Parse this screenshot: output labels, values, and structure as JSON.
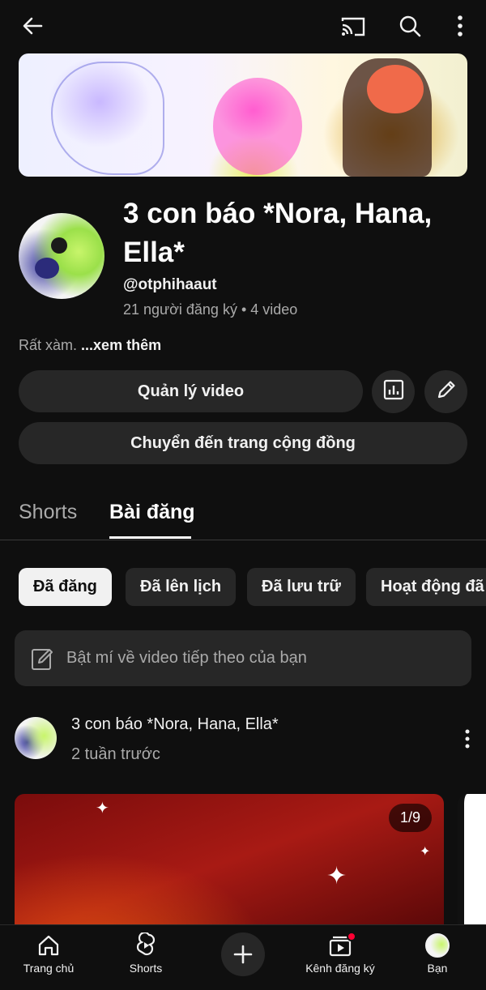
{
  "header": {
    "back_icon": "arrow-left-icon",
    "cast_icon": "cast-icon",
    "search_icon": "search-icon",
    "more_icon": "more-vert-icon"
  },
  "channel": {
    "name": "3 con báo *Nora, Hana, Ella*",
    "handle": "@otphihaaut",
    "stats": "21 người đăng ký • 4 video",
    "description": "Rất xàm.",
    "more_link": "...xem thêm"
  },
  "actions": {
    "manage_videos": "Quản lý video",
    "analytics_icon": "analytics-icon",
    "edit_icon": "pencil-icon",
    "community": "Chuyển đến trang cộng đồng"
  },
  "tabs": [
    {
      "label": "Shorts",
      "active": false
    },
    {
      "label": "Bài đăng",
      "active": true
    }
  ],
  "chips": [
    {
      "label": "Đã đăng",
      "active": true
    },
    {
      "label": "Đã lên lịch",
      "active": false
    },
    {
      "label": "Đã lưu trữ",
      "active": false
    },
    {
      "label": "Hoạt động đã",
      "active": false
    }
  ],
  "composer": {
    "placeholder": "Bật mí về video tiếp theo của bạn"
  },
  "post": {
    "author": "3 con báo *Nora, Hana, Ella*",
    "time": "2 tuần trước",
    "image_counter": "1/9"
  },
  "bottom_nav": [
    {
      "label": "Trang chủ",
      "icon": "home-icon"
    },
    {
      "label": "Shorts",
      "icon": "shorts-icon"
    },
    {
      "label": "",
      "icon": "add-icon"
    },
    {
      "label": "Kênh đăng ký",
      "icon": "subscriptions-icon"
    },
    {
      "label": "Bạn",
      "icon": "avatar"
    }
  ],
  "colors": {
    "background": "#0f0f0f",
    "surface": "#272727",
    "text_primary": "#f1f1f1",
    "text_secondary": "#aaaaaa",
    "notification_dot": "#ff0033"
  }
}
